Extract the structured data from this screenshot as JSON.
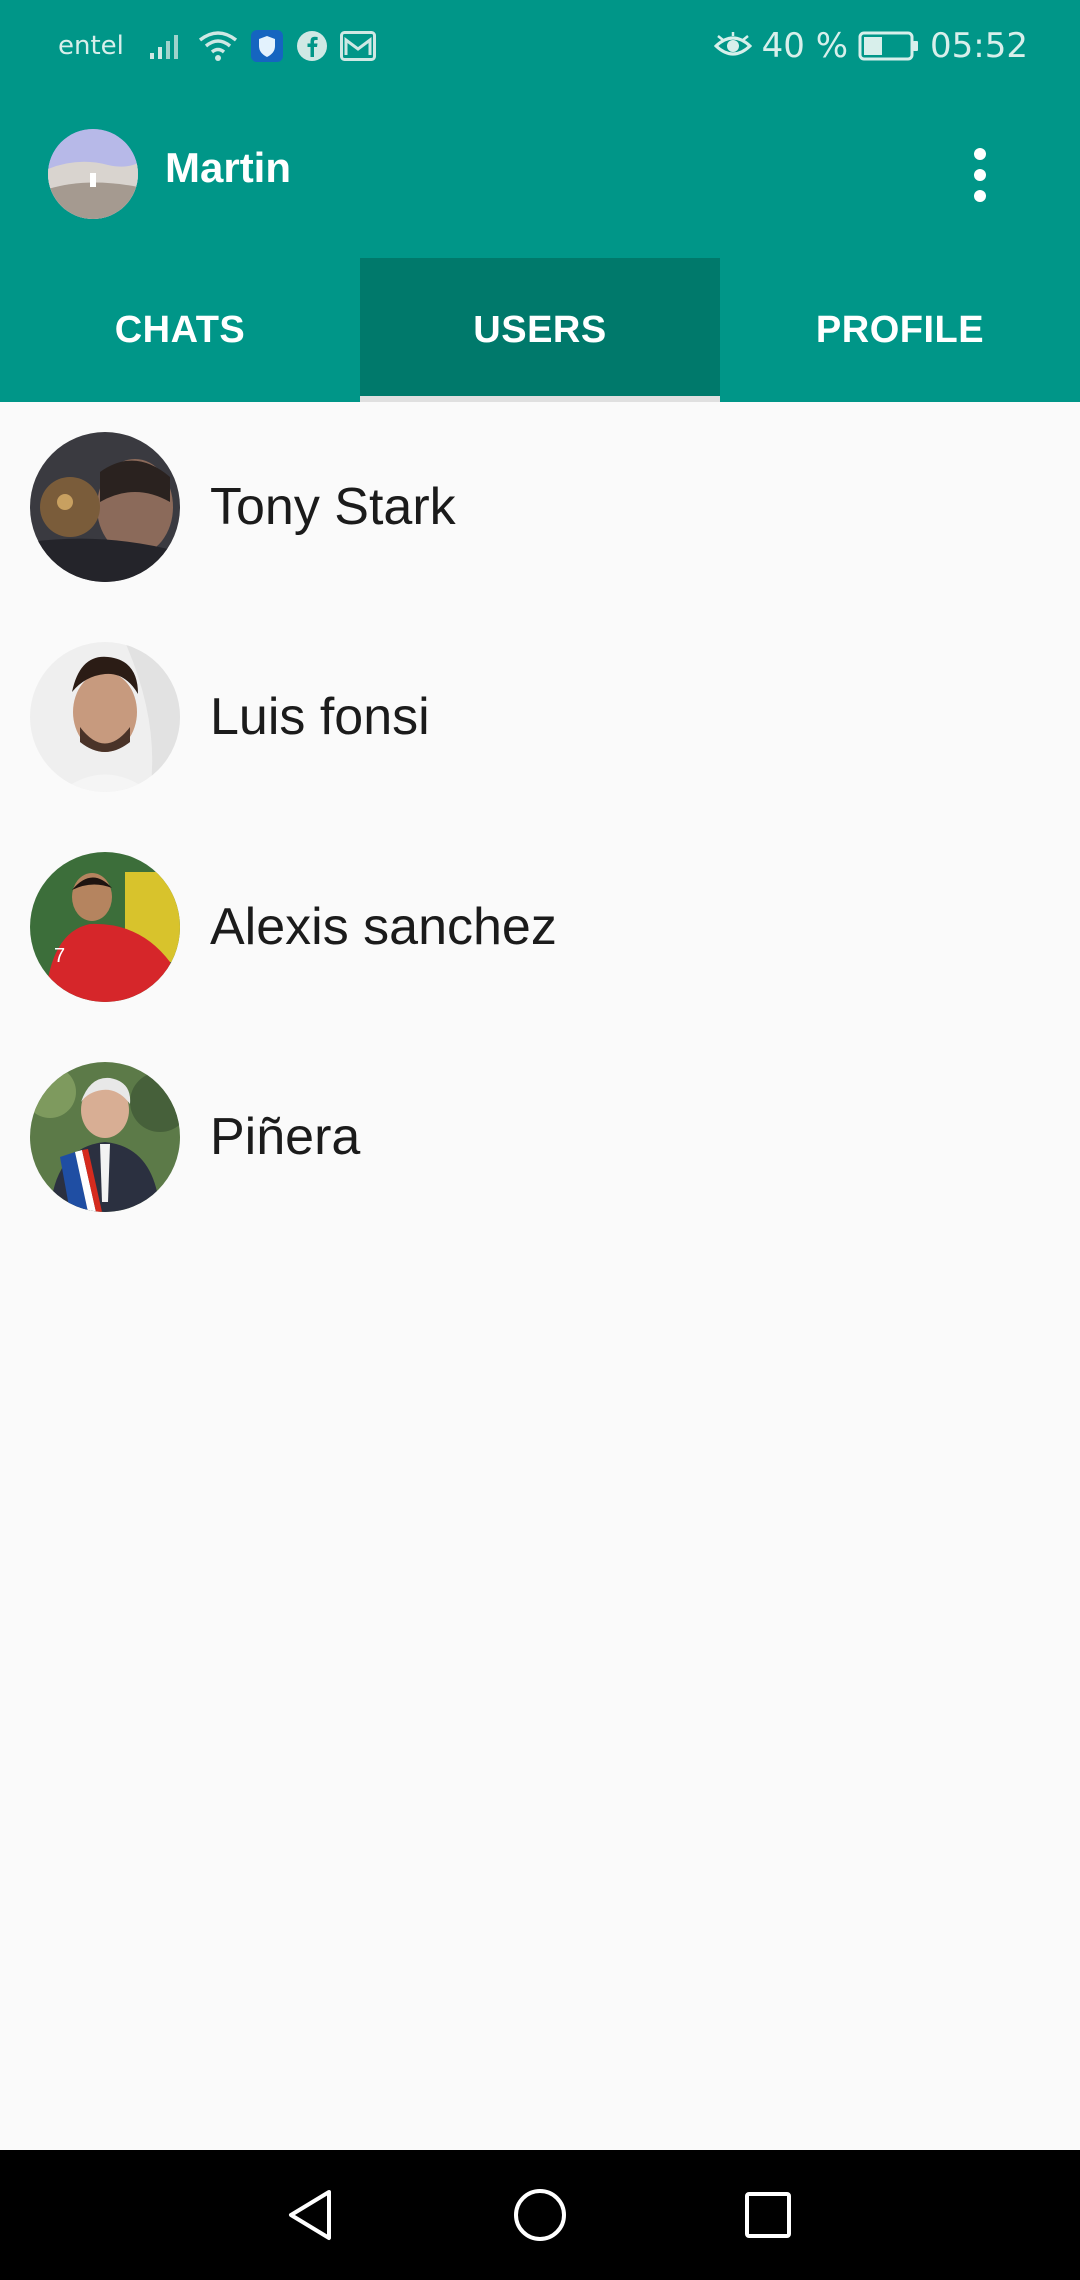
{
  "status_bar": {
    "carrier": "entel",
    "battery_percent": "40 %",
    "time": "05:52",
    "icons": [
      "signal-icon",
      "wifi-icon",
      "shield-icon",
      "facebook-icon",
      "mail-icon",
      "eye-icon",
      "battery-icon"
    ]
  },
  "app_bar": {
    "title": "Martin",
    "menu_icon": "more-vertical-icon"
  },
  "tabs": [
    {
      "label": "CHATS",
      "active": false
    },
    {
      "label": "USERS",
      "active": true
    },
    {
      "label": "PROFILE",
      "active": false
    }
  ],
  "users": [
    {
      "name": "Tony Stark"
    },
    {
      "name": "Luis fonsi"
    },
    {
      "name": "Alexis sanchez"
    },
    {
      "name": "Piñera"
    }
  ],
  "colors": {
    "primary": "#009688",
    "primary_dark": "#00796b",
    "background": "#fafafa"
  },
  "nav_bar": {
    "icons": [
      "back-icon",
      "home-icon",
      "recents-icon"
    ]
  }
}
